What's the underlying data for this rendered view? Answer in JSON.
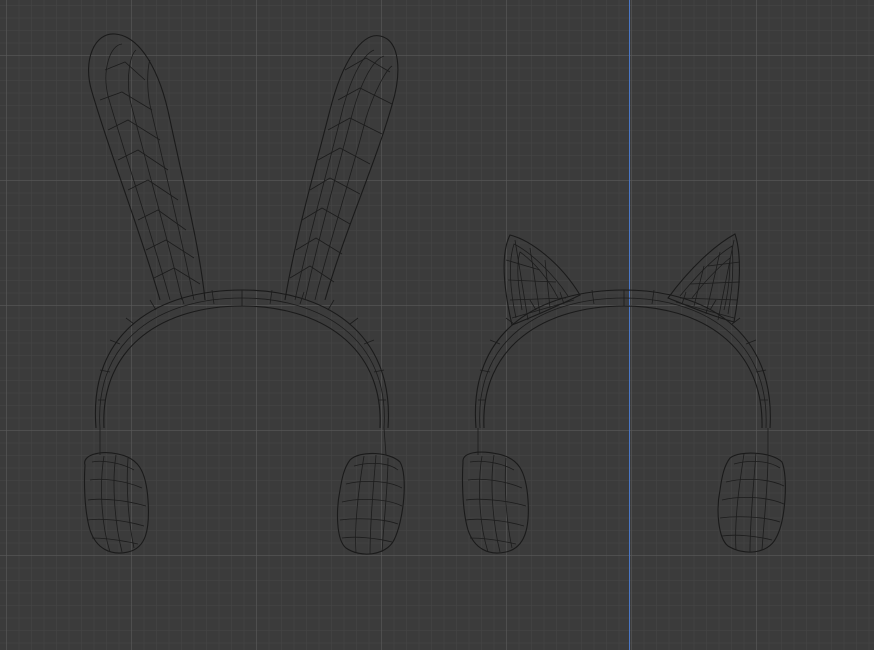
{
  "viewport": {
    "mode": "wireframe",
    "background_color": "#3b3b3b",
    "grid_color": "#5a5a5a",
    "axis_color": "#4a78c8",
    "wire_color": "#1c1c1c"
  },
  "objects": [
    {
      "name": "bunny-ear-headphones"
    },
    {
      "name": "cat-ear-headphones"
    }
  ]
}
